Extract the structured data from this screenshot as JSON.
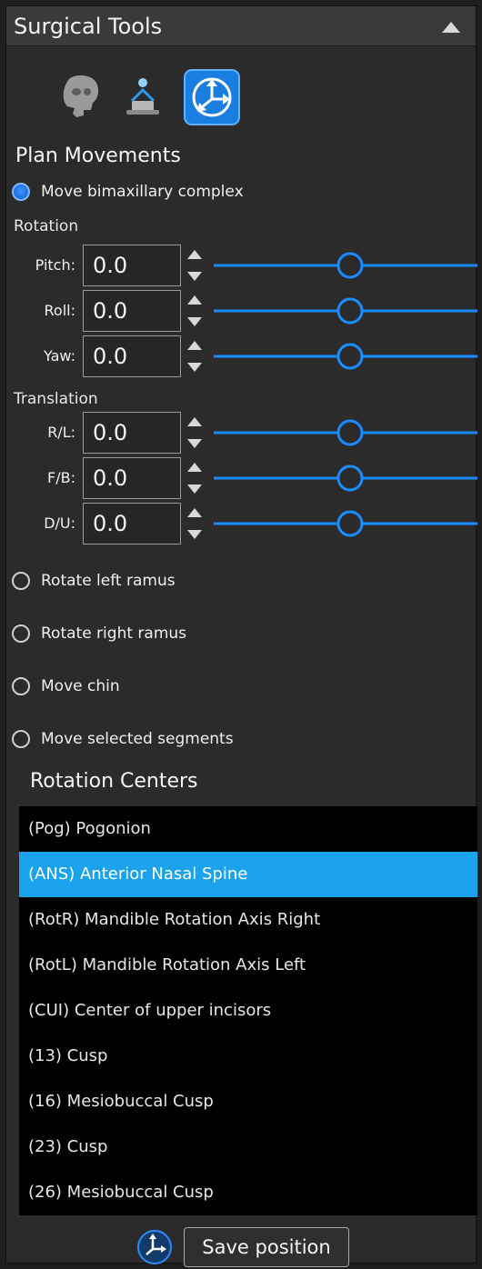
{
  "panel": {
    "title": "Surgical Tools",
    "collapse_icon": "triangle-up-icon"
  },
  "tools": [
    {
      "icon": "skull-icon",
      "selected": false
    },
    {
      "icon": "patient-chair-icon",
      "selected": false
    },
    {
      "icon": "move-axes-icon",
      "selected": true
    }
  ],
  "plan": {
    "title": "Plan Movements",
    "options": [
      {
        "label": "Move bimaxillary complex",
        "checked": true
      },
      {
        "label": "Rotate left ramus",
        "checked": false
      },
      {
        "label": "Rotate right ramus",
        "checked": false
      },
      {
        "label": "Move chin",
        "checked": false
      },
      {
        "label": "Move selected segments",
        "checked": false
      }
    ],
    "rotation": {
      "label": "Rotation",
      "params": [
        {
          "label": "Pitch:",
          "value": "0.0",
          "slider": 0.5
        },
        {
          "label": "Roll:",
          "value": "0.0",
          "slider": 0.5
        },
        {
          "label": "Yaw:",
          "value": "0.0",
          "slider": 0.5
        }
      ]
    },
    "translation": {
      "label": "Translation",
      "params": [
        {
          "label": "R/L:",
          "value": "0.0",
          "slider": 0.5
        },
        {
          "label": "F/B:",
          "value": "0.0",
          "slider": 0.5
        },
        {
          "label": "D/U:",
          "value": "0.0",
          "slider": 0.5
        }
      ]
    }
  },
  "rotation_centers": {
    "title": "Rotation Centers",
    "items": [
      {
        "label": "(Pog) Pogonion",
        "selected": false
      },
      {
        "label": "(ANS) Anterior Nasal Spine",
        "selected": true
      },
      {
        "label": "(RotR) Mandible Rotation Axis Right",
        "selected": false
      },
      {
        "label": "(RotL) Mandible Rotation Axis Left",
        "selected": false
      },
      {
        "label": "(CUI) Center of upper incisors",
        "selected": false
      },
      {
        "label": "(13) Cusp",
        "selected": false
      },
      {
        "label": "(16) Mesiobuccal Cusp",
        "selected": false
      },
      {
        "label": "(23) Cusp",
        "selected": false
      },
      {
        "label": "(26) Mesiobuccal Cusp",
        "selected": false
      }
    ]
  },
  "footer": {
    "move_icon": "move-axes-icon",
    "save_label": "Save position"
  },
  "colors": {
    "accent": "#1a8cff",
    "selection": "#1aa3ec",
    "panel_bg": "#2b2b2b",
    "list_bg": "#000000"
  }
}
